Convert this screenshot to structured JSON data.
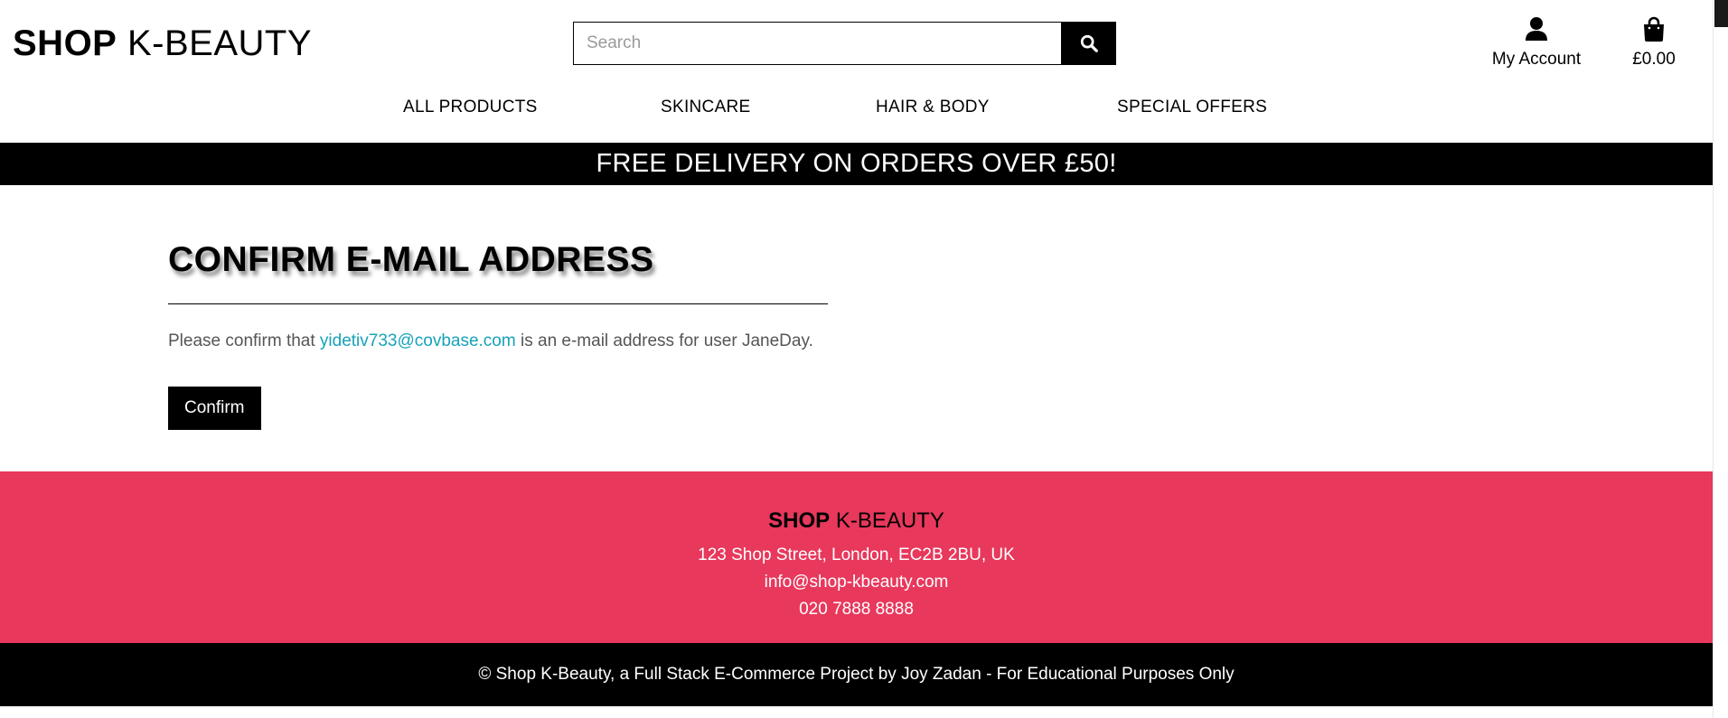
{
  "header": {
    "logo_bold": "SHOP",
    "logo_light": "K-BEAUTY",
    "search_placeholder": "Search",
    "search_icon": "search-icon",
    "account_label": "My Account",
    "account_icon": "user-icon",
    "bag_total": "£0.00",
    "bag_icon": "shopping-bag-icon"
  },
  "nav": {
    "items": [
      {
        "label": "ALL PRODUCTS"
      },
      {
        "label": "SKINCARE"
      },
      {
        "label": "HAIR & BODY"
      },
      {
        "label": "SPECIAL OFFERS"
      }
    ]
  },
  "banner": {
    "text": "FREE DELIVERY ON ORDERS OVER £50!"
  },
  "main": {
    "title": "CONFIRM E-MAIL ADDRESS",
    "text_before": "Please confirm that ",
    "email": "yidetiv733@covbase.com",
    "text_after": " is an e-mail address for user JaneDay.",
    "confirm_label": "Confirm"
  },
  "footer": {
    "logo_bold": "SHOP",
    "logo_light": "K-BEAUTY",
    "address": "123 Shop Street, London, EC2B 2BU, UK",
    "email": "info@shop-kbeauty.com",
    "phone": "020 7888 8888",
    "copyright": "© Shop K-Beauty, a Full Stack E-Commerce Project by Joy Zadan - For Educational Purposes Only"
  },
  "colors": {
    "accent_pink": "#e8385c",
    "link_teal": "#17a2b8",
    "black": "#000000"
  }
}
